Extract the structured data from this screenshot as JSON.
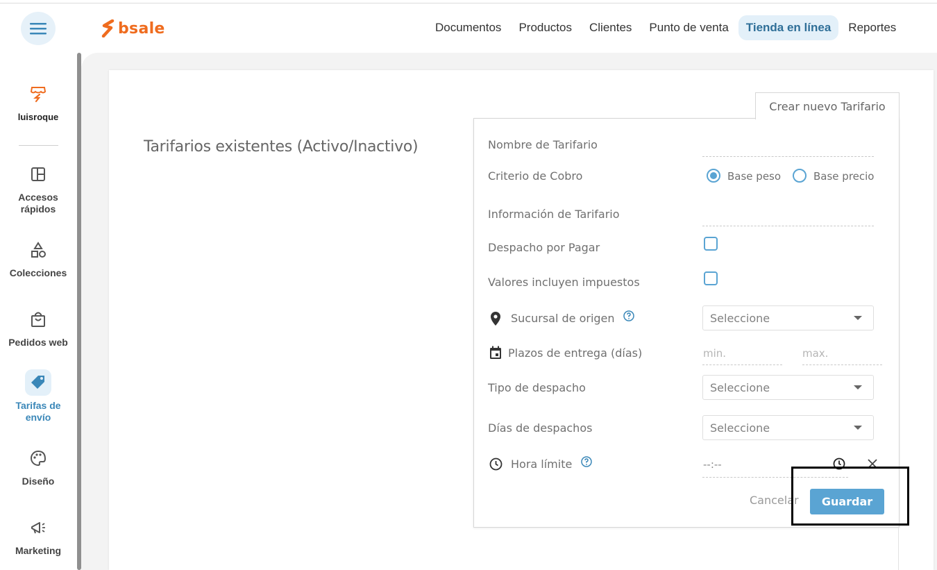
{
  "brand": {
    "name": "bsale",
    "color": "#ef6c1f",
    "accent": "#5aa4d3"
  },
  "nav": [
    {
      "label": "Documentos"
    },
    {
      "label": "Productos"
    },
    {
      "label": "Clientes"
    },
    {
      "label": "Punto de venta"
    },
    {
      "label": "Tienda en línea",
      "active": true
    },
    {
      "label": "Reportes"
    }
  ],
  "sidebar": {
    "store": {
      "label": "luisroque",
      "icon": "store-icon"
    },
    "items": [
      {
        "label": "Accesos rápidos",
        "icon": "layout-icon"
      },
      {
        "label": "Colecciones",
        "icon": "shapes-icon"
      },
      {
        "label": "Pedidos web",
        "icon": "shopping-bag-icon"
      },
      {
        "label": "Tarifas de envío",
        "icon": "price-tag-icon",
        "active": true
      },
      {
        "label": "Diseño",
        "icon": "palette-icon"
      },
      {
        "label": "Marketing",
        "icon": "megaphone-icon"
      }
    ]
  },
  "main": {
    "section_title": "Tarifarios existentes (Activo/Inactivo)",
    "tab_label": "Crear nuevo Tarifario",
    "form": {
      "nombre_label": "Nombre de Tarifario",
      "nombre_value": "",
      "criterio_label": "Criterio de Cobro",
      "criterio_options": [
        "Base peso",
        "Base precio"
      ],
      "criterio_selected": "Base peso",
      "info_label": "Información de Tarifario",
      "info_value": "",
      "despacho_pagar_label": "Despacho por Pagar",
      "impuestos_label": "Valores incluyen impuestos",
      "sucursal_label": "Sucursal de origen",
      "sucursal_value": "Seleccione",
      "plazos_label": "Plazos de entrega (días)",
      "plazo_min_placeholder": "min.",
      "plazo_max_placeholder": "max.",
      "tipo_despacho_label": "Tipo de despacho",
      "tipo_despacho_value": "Seleccione",
      "dias_despacho_label": "Días de despachos",
      "dias_despacho_value": "Seleccione",
      "hora_label": "Hora límite",
      "hora_value": "--:--",
      "cancel_label": "Cancelar",
      "save_label": "Guardar"
    }
  }
}
